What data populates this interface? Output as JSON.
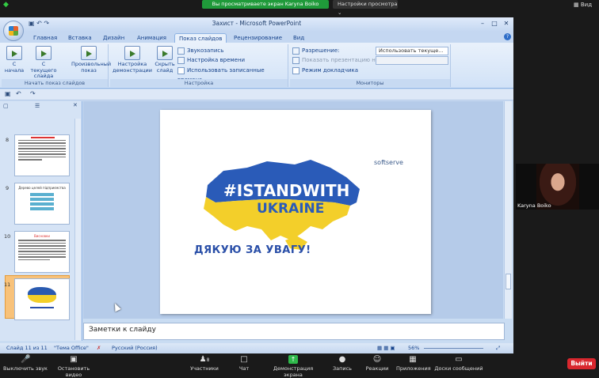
{
  "zoom": {
    "share_banner": "Вы просматриваете экран Karyna Boiko",
    "view_options": "Настройки просмотра",
    "view_label": "Вид",
    "participant_name": "Karyna Boiko",
    "bottom": {
      "mute": "Выключить звук",
      "video": "Остановить видео",
      "participants": "Участники",
      "participants_count": "8",
      "chat": "Чат",
      "share": "Демонстрация экрана",
      "record": "Запись",
      "reactions": "Реакции",
      "apps": "Приложения",
      "whiteboards": "Доски сообщений",
      "leave": "Выйти"
    }
  },
  "ppt": {
    "title": "Захист - Microsoft PowerPoint",
    "tabs": [
      "Главная",
      "Вставка",
      "Дизайн",
      "Анимация",
      "Показ слайдов",
      "Рецензирование",
      "Вид"
    ],
    "active_tab": "Показ слайдов",
    "ribbon": {
      "start_group_label": "Начать показ слайдов",
      "from_beginning": "С начала",
      "from_current": "С текущего слайда",
      "custom_show": "Произвольный показ",
      "setup_show": "Настройка демонстрации",
      "hide_slide": "Скрыть слайд",
      "record_narration": "Звукозапись",
      "rehearse_timings": "Настройка времени",
      "use_timings": "Использовать записанные времена",
      "setup_group_label": "Настройка",
      "resolution_label": "Разрешение:",
      "resolution_value": "Использовать текуще...",
      "show_on_label": "Показать презентацию на:",
      "presenter_view": "Режим докладчика",
      "monitors_group_label": "Мониторы"
    },
    "thumbnails": [
      {
        "num": "8"
      },
      {
        "num": "9",
        "caption": "Дерево целей підприємства"
      },
      {
        "num": "10",
        "caption": "Висновки"
      },
      {
        "num": "11"
      }
    ],
    "slide": {
      "brand": "softserve",
      "hashtag_line1": "#ISTANDWITH",
      "hashtag_line2": "UKRAINE",
      "thanks": "ДЯКУЮ ЗА УВАГУ!"
    },
    "notes_placeholder": "Заметки к слайду",
    "status": {
      "slide_info": "Слайд 11 из 11",
      "theme": "\"Тема Office\"",
      "language": "Русский (Россия)",
      "zoom": "56%"
    }
  }
}
